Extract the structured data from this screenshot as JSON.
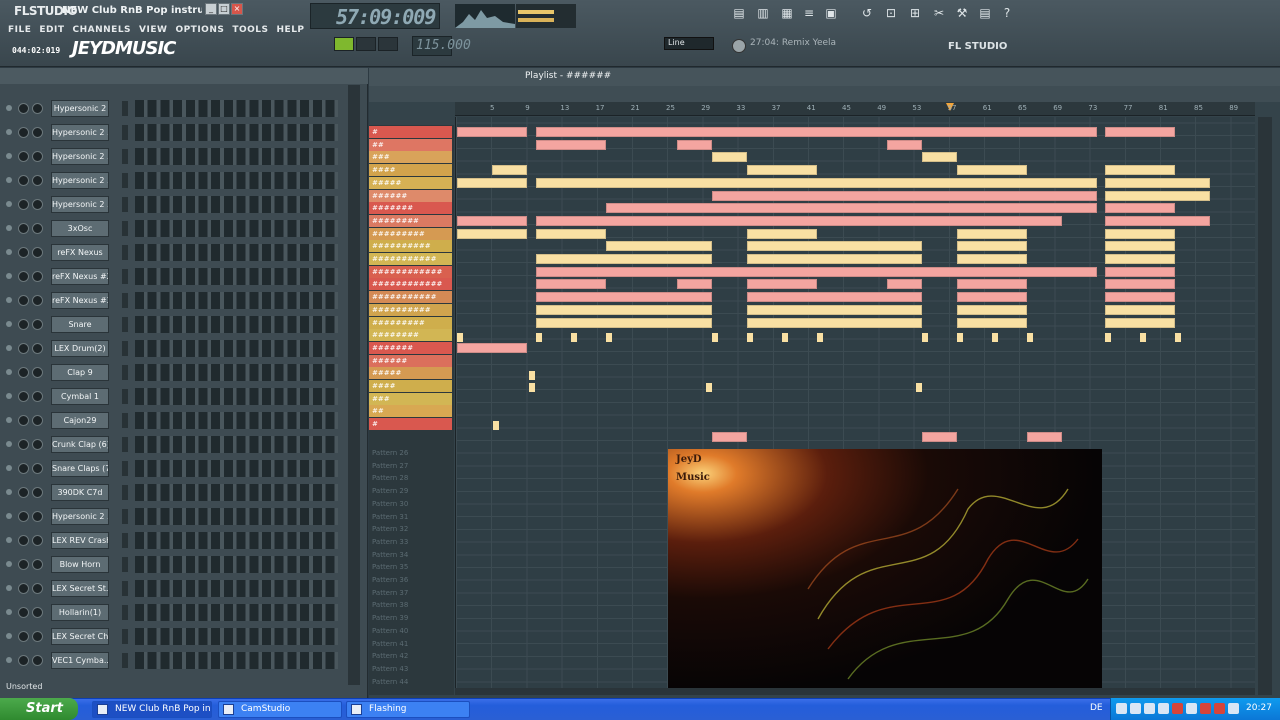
{
  "app": {
    "logo": "FLSTUDIO",
    "window_title": "NEW Club RnB Pop instrumen...",
    "song_position": "044:02:019",
    "brand": "JEYDMUSIC",
    "time_display": "57:09:009",
    "tempo": "115.000",
    "hint": "27:04: Remix Yeela",
    "fl_label": "FL STUDIO",
    "snap_label": "Line",
    "window_buttons": [
      "_",
      "□",
      "×"
    ]
  },
  "menu": [
    "FILE",
    "EDIT",
    "CHANNELS",
    "VIEW",
    "OPTIONS",
    "TOOLS",
    "HELP"
  ],
  "channels": [
    "Hypersonic 2",
    "Hypersonic 2 ...",
    "Hypersonic 2 ...",
    "Hypersonic 2 ...",
    "Hypersonic 2 ...",
    "3xOsc",
    "reFX Nexus",
    "reFX Nexus #2",
    "reFX Nexus #3",
    "Snare",
    "LEX Drum(2)",
    "Clap 9",
    "Cymbal 1",
    "Cajon29",
    "Crunk Clap (6)",
    "Snare Claps (7)",
    "390DK C7d",
    "Hypersonic 2 ...",
    "LEX REV Crash",
    "Blow Horn",
    "LEX Secret St...",
    "Hollarin(1)",
    "LEX Secret Ch...",
    "VEC1 Cymba..."
  ],
  "rack_footer": "Unsorted",
  "playlist": {
    "title": "Playlist - ######",
    "ruler_ticks": [
      "5",
      "9",
      "13",
      "17",
      "21",
      "25",
      "29",
      "33",
      "37",
      "41",
      "45",
      "49",
      "53",
      "57",
      "61",
      "65",
      "69",
      "73",
      "77",
      "81",
      "85",
      "89"
    ],
    "patterns": [
      {
        "label": "#",
        "color": "#d9584f"
      },
      {
        "label": "##",
        "color": "#de7663"
      },
      {
        "label": "###",
        "color": "#d9a35a"
      },
      {
        "label": "####",
        "color": "#d2a34c"
      },
      {
        "label": "#####",
        "color": "#d6b154"
      },
      {
        "label": "######",
        "color": "#de8a6a"
      },
      {
        "label": "#######",
        "color": "#d9584f"
      },
      {
        "label": "########",
        "color": "#db7a62"
      },
      {
        "label": "#########",
        "color": "#d59a52"
      },
      {
        "label": "##########",
        "color": "#cfae4c"
      },
      {
        "label": "###########",
        "color": "#d2b654"
      },
      {
        "label": "############",
        "color": "#d9604f"
      },
      {
        "label": "############",
        "color": "#d9584f"
      },
      {
        "label": "###########",
        "color": "#d48a55"
      },
      {
        "label": "##########",
        "color": "#d0a44e"
      },
      {
        "label": "#########",
        "color": "#cfae4c"
      },
      {
        "label": "########",
        "color": "#d2b654"
      },
      {
        "label": "#######",
        "color": "#d9584f"
      },
      {
        "label": "######",
        "color": "#db6f5c"
      },
      {
        "label": "#####",
        "color": "#d59a52"
      },
      {
        "label": "####",
        "color": "#cfae4c"
      },
      {
        "label": "###",
        "color": "#d2b654"
      },
      {
        "label": "##",
        "color": "#d8a852"
      },
      {
        "label": "#",
        "color": "#d9584f"
      }
    ],
    "empty_patterns": [
      "Pattern 26",
      "Pattern 27",
      "Pattern 28",
      "Pattern 29",
      "Pattern 30",
      "Pattern 31",
      "Pattern 32",
      "Pattern 33",
      "Pattern 34",
      "Pattern 35",
      "Pattern 36",
      "Pattern 37",
      "Pattern 38",
      "Pattern 39",
      "Pattern 40",
      "Pattern 41",
      "Pattern 42",
      "Pattern 43",
      "Pattern 44"
    ],
    "artwork_text": [
      "JeyD",
      "Music"
    ]
  },
  "taskbar": {
    "start": "Start",
    "tasks": [
      "NEW Club RnB Pop in...",
      "CamStudio",
      "Flashing"
    ],
    "lang": "DE",
    "clock": "20:27"
  },
  "colors": {
    "clip_pink": "#f4a5a0",
    "clip_yellow": "#f9e0a3",
    "play_green": "#7fb82e"
  }
}
